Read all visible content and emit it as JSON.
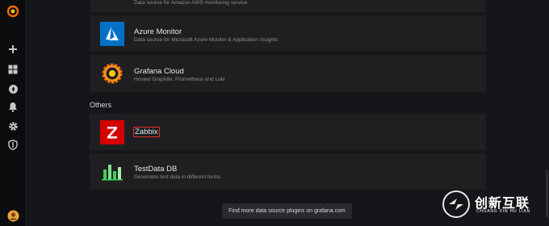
{
  "sidebar": {
    "items": [
      {
        "name": "grafana-logo-icon"
      },
      {
        "name": "plus-icon"
      },
      {
        "name": "dashboards-icon"
      },
      {
        "name": "explore-icon"
      },
      {
        "name": "bell-icon"
      },
      {
        "name": "gear-icon"
      },
      {
        "name": "shield-icon"
      },
      {
        "name": "avatar"
      }
    ]
  },
  "datasources": {
    "cloudwatch": {
      "desc": "Data source for Amazon AWS monitoring service"
    },
    "azure": {
      "name": "Azure Monitor",
      "desc": "Data source for Microsoft Azure Monitor & Application Insights"
    },
    "grafana_cloud": {
      "name": "Grafana Cloud",
      "desc": "Hosted Graphite, Prometheus and Loki"
    }
  },
  "others": {
    "title": "Others",
    "zabbix": {
      "name": "Zabbix"
    },
    "testdata": {
      "name": "TestData DB",
      "desc": "Generates test data in different forms"
    }
  },
  "footer": {
    "more_button": "Find more data source plugins on grafana.com"
  },
  "watermark": {
    "main": "创新互联",
    "sub": "CHUANG XIN HU LIAN"
  },
  "colors": {
    "zabbix_red": "#d40000",
    "azure_blue": "#0072c6",
    "grafana_orange": "#f46800",
    "testdata_green": "#3ecf5c",
    "highlight_red": "#e02f2f"
  }
}
